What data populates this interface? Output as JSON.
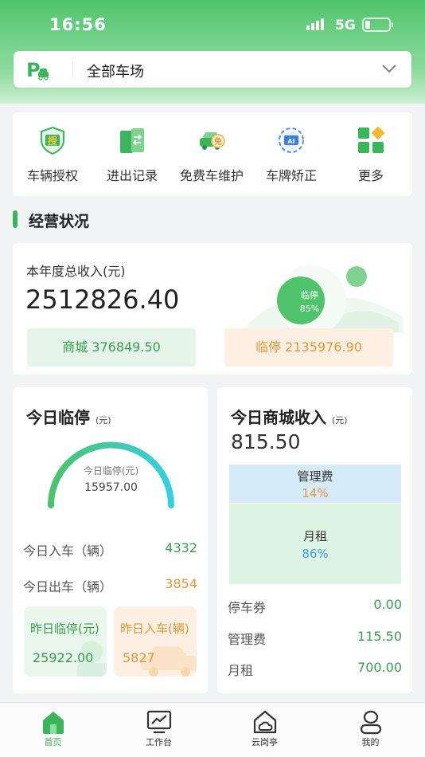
{
  "status_bar": {
    "time": "16:56",
    "network": "5G"
  },
  "lot_selector": {
    "label": "全部车场"
  },
  "quick_actions": [
    {
      "label": "车辆授权",
      "icon": "vehicle-authorize-icon",
      "badge": "授"
    },
    {
      "label": "进出记录",
      "icon": "entry-exit-record-icon"
    },
    {
      "label": "免费车维护",
      "icon": "free-car-icon",
      "badge": "免"
    },
    {
      "label": "车牌矫正",
      "icon": "plate-correct-icon",
      "badge": "AI"
    },
    {
      "label": "更多",
      "icon": "more-grid-icon"
    }
  ],
  "section": {
    "title": "经营状况"
  },
  "annual": {
    "label": "本年度总收入(元)",
    "value": "2512826.40",
    "pie_label": "临停",
    "pie_pct": "85%",
    "mall_chip": "商城 376849.50",
    "temp_chip": "临停 2135976.90"
  },
  "today_temp": {
    "title": "今日临停",
    "unit": "(元)",
    "gauge_label": "今日临停(元)",
    "gauge_value": "15957.00",
    "gauge_fraction": 1.0,
    "entry_label": "今日入车（辆）",
    "entry_value": "4332",
    "exit_label": "今日出车（辆）",
    "exit_value": "3854",
    "yesterday_temp_label": "昨日临停(元)",
    "yesterday_temp_value": "25922.00",
    "yesterday_entry_label": "昨日入车(辆)",
    "yesterday_entry_value": "5827"
  },
  "today_mall": {
    "title": "今日商城收入",
    "unit": "(元)",
    "value": "815.50",
    "fee_name": "管理费",
    "fee_pct": "14%",
    "rent_name": "月租",
    "rent_pct": "86%",
    "coupon_label": "停车券",
    "coupon_value": "0.00",
    "fee_label": "管理费",
    "fee_value": "115.50",
    "rent_label": "月租",
    "rent_value": "700.00"
  },
  "tabs": [
    {
      "label": "首页",
      "icon": "home-icon"
    },
    {
      "label": "工作台",
      "icon": "workbench-icon"
    },
    {
      "label": "云岗亭",
      "icon": "cloud-booth-icon"
    },
    {
      "label": "我的",
      "icon": "profile-icon"
    }
  ],
  "colors": {
    "brand_green": "#3ab55c",
    "orange": "#e3963a",
    "blue": "#3d9de8"
  }
}
